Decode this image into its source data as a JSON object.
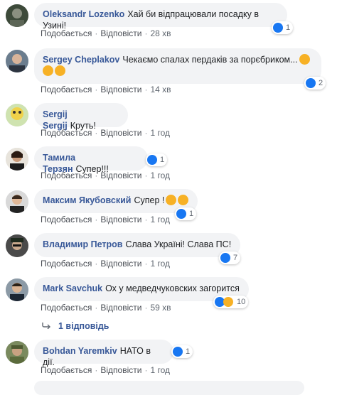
{
  "actions": {
    "like": "Подобається",
    "reply": "Відповісти"
  },
  "comments": [
    {
      "name": "Oleksandr Lozenko",
      "text": "Хай би відпрацювали посадку в Узині!",
      "time": "28 хв",
      "reactions": "1"
    },
    {
      "name": "Sergey Cheplakov",
      "text": "Чекаємо спалах пердаків за порєбриком...",
      "time": "14 хв",
      "reactions": "2"
    },
    {
      "name": "Sergij Sergij",
      "text": "Круть!",
      "time": "1 год",
      "reactions": ""
    },
    {
      "name": "Тамила Терзян",
      "text": "Супер!!!",
      "time": "1 год",
      "reactions": "1"
    },
    {
      "name": "Максим Якубовский",
      "text": "Супер !",
      "time": "1 год",
      "reactions": "1"
    },
    {
      "name": "Владимир Петров",
      "text": "Слава Україні! Слава ПС!",
      "time": "1 год",
      "reactions": "7"
    },
    {
      "name": "Mark Savchuk",
      "text": "Ох у медведчуковских загорится",
      "time": "59 хв",
      "reactions": "10"
    },
    {
      "name": "Bohdan Yaremkiv",
      "text": "НАТО в дії.",
      "time": "1 год",
      "reactions": "1"
    }
  ],
  "replies_link": "1 відповідь",
  "colors": {
    "link": "#385898",
    "bubble": "#f2f3f5",
    "like": "#1877f2",
    "haha": "#f7b125"
  },
  "icons": {
    "like": "thumbs-up-icon",
    "haha": "laughing-face-icon",
    "wow": "screaming-face-icon",
    "reply_arrow": "reply-arrow-icon"
  }
}
